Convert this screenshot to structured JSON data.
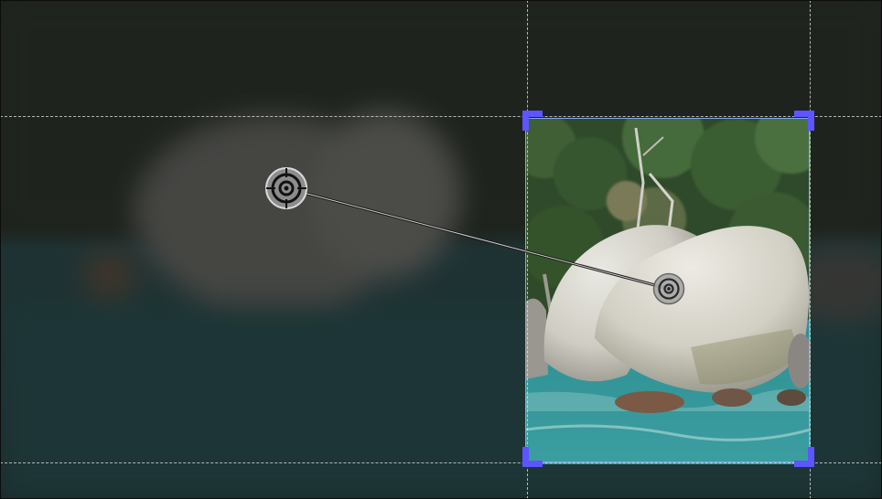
{
  "editor": {
    "mode": "crop-pan-transition",
    "colors": {
      "handle": "#5d55ff",
      "crop_border": "#7aa6ff",
      "guide": "#e6e6e6",
      "dim_overlay": "#000000"
    },
    "icons": {
      "start_target": "crosshair-target-icon",
      "end_target": "crosshair-target-icon"
    }
  }
}
